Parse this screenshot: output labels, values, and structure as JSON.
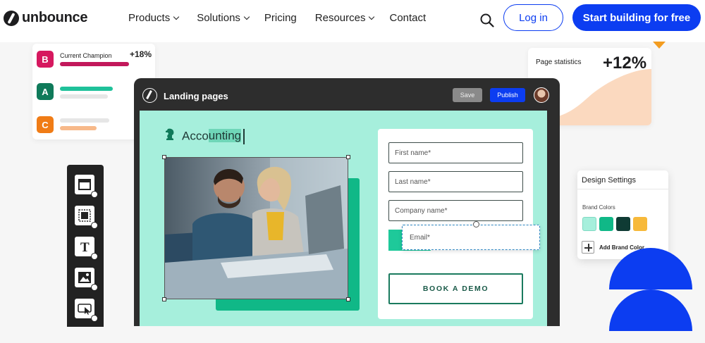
{
  "nav": {
    "logo_text": "unbounce",
    "menu": [
      {
        "label": "Products",
        "dropdown": true
      },
      {
        "label": "Solutions",
        "dropdown": true
      },
      {
        "label": "Pricing",
        "dropdown": false
      },
      {
        "label": "Resources",
        "dropdown": true
      },
      {
        "label": "Contact",
        "dropdown": false
      }
    ],
    "login_label": "Log in",
    "cta_label": "Start building for free",
    "search_icon": "search-icon",
    "accent_color": "#0c3df1"
  },
  "variants": {
    "champion_label": "Current Champion",
    "champion_pct": "+18%",
    "items": [
      {
        "letter": "B",
        "color": "#d6185f",
        "bar_color": "#c2185b"
      },
      {
        "letter": "A",
        "color": "#0f7a5a",
        "bar_color": "#1fc19a"
      },
      {
        "letter": "C",
        "color": "#f07c16",
        "bar_color": "#f7b98a"
      }
    ]
  },
  "stats": {
    "title": "Page statistics",
    "pct": "+12%"
  },
  "editor": {
    "title": "Landing pages",
    "save_label": "Save",
    "publish_label": "Publish",
    "headline_plain": "Acco",
    "headline_highlight": "unting",
    "form": {
      "fields": [
        "First name*",
        "Last name*",
        "Company name*"
      ],
      "email_placeholder": "Email*",
      "button_label": "BOOK A DEMO"
    }
  },
  "design_settings": {
    "title": "Design Settings",
    "brand_colors_label": "Brand Colors",
    "swatches": [
      "#a6efdc",
      "#10b887",
      "#0f3b34",
      "#f7b93a"
    ],
    "add_label": "Add Brand Color"
  },
  "tools": [
    "section-tool-icon",
    "box-tool-icon",
    "text-tool-icon",
    "image-tool-icon",
    "button-tool-icon"
  ]
}
